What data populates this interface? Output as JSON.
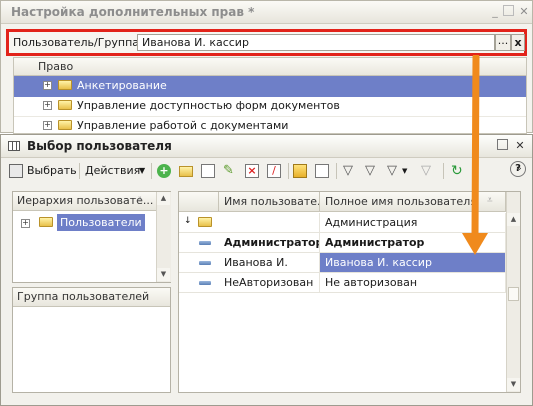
{
  "back_window": {
    "title": "Настройка дополнительных прав *",
    "user_group_label": "Пользователь/Группа:",
    "user_group_value": "Иванова И. кассир",
    "select_button": "...",
    "clear_button": "x",
    "rights_header": "Право",
    "rights": [
      {
        "label": "Анкетирование",
        "selected": true
      },
      {
        "label": "Управление доступностью форм документов",
        "selected": false
      },
      {
        "label": "Управление работой с документами",
        "selected": false
      }
    ]
  },
  "front_window": {
    "title": "Выбор пользователя",
    "toolbar": {
      "select_label": "Выбрать",
      "actions_label": "Действия"
    },
    "hierarchy_panel": {
      "header": "Иерархия пользовате...",
      "root_item": "Пользователи"
    },
    "group_panel": {
      "header": "Группа пользователей"
    },
    "users_table": {
      "columns": [
        "Имя пользовате...",
        "Полное имя пользователя"
      ],
      "rows": [
        {
          "name": "",
          "full_name": "Администрация",
          "kind": "folder",
          "bold": false,
          "selected": false
        },
        {
          "name": "Администратор",
          "full_name": "Администратор",
          "kind": "user",
          "bold": true,
          "selected": false
        },
        {
          "name": "Иванова И.",
          "full_name": "Иванова И. кассир",
          "kind": "user",
          "bold": false,
          "selected": true
        },
        {
          "name": "НеАвторизован",
          "full_name": "Не авторизован",
          "kind": "user",
          "bold": false,
          "selected": false
        }
      ]
    }
  },
  "colors": {
    "highlight": "#e2231a",
    "selection": "#6e7fc8",
    "arrow": "#f08a1c"
  },
  "icons": [
    "plus-icon",
    "folder-icon",
    "user-icon",
    "help-icon",
    "window-icon",
    "filter-icon",
    "refresh-icon"
  ]
}
